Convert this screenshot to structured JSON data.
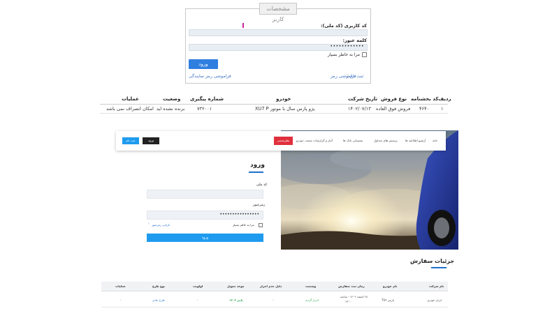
{
  "login_box": {
    "legend": "مشخصات کاربر",
    "national_code_label": "کد کاربری (کد ملی):",
    "password_label": "کلمه عبور:",
    "password_value": "••••••••••••",
    "remember_label": "مرا به خاطر بسپار",
    "login_button": "ورود",
    "register_link": "ثبت نام",
    "separator": "|",
    "forgot_password_link": "فراموشی رمز",
    "forgot_agent_password_link": "فراموشی رمز نمایندگی"
  },
  "orders_table": {
    "headers": [
      "ردیف",
      "کد بخشنامه",
      "نوع فروش",
      "تاریخ شرکت",
      "خودرو",
      "شماره پیگیری",
      "وضعیت",
      "عملیات"
    ],
    "rows": [
      {
        "row": "۱",
        "circular": "۴۶۴۰",
        "sale_type": "فروش فوق العاده",
        "date": "۱۴۰۲/۰۷/۱۳",
        "car": "پژو پارس سال با موتور XU7 P",
        "tracking": "۷۳۲۰۰۱",
        "status": "برنده نشده اید",
        "ops": "امکان انصراف نمی باشد"
      }
    ]
  },
  "navbar": {
    "items": [
      "خانه",
      "آرشیو اطلاعیه ها",
      "پرسش های متداول",
      "پشتیبانی بانک ها",
      "آمار و گزارشات صنعت خودرو"
    ],
    "survey_button": "نظرسنجی",
    "login_button": "ورود",
    "register_button": "ثبت نام"
  },
  "login_form2": {
    "title": "ورود",
    "national_code_label": "کد ملی",
    "password_label": "رمزعبور",
    "password_value": "••••••••••••••••",
    "remember_label": "مرا به خاطر بسپار",
    "forgot_link": "بازیابی رمزعبور",
    "submit_button": "ورود"
  },
  "order_details": {
    "title": "جزئیات سفارش",
    "headers": [
      "نام شرکت",
      "نام خودرو",
      "زمان ثبت سفارش",
      "وضعیت",
      "دلیل عدم احراز",
      "موعد تحویل",
      "اولویت",
      "نوع طرح",
      "عملیات"
    ],
    "row": {
      "company": "ایران خودرو",
      "car": "پارس TU۳",
      "time_line1": "۲۸ اسفند ۱۴۰۲ - ساعت",
      "time_line2": "۱۳:۰۰",
      "status": "احراز گردید",
      "reason": "-",
      "delivery": "پاییز ۱۴۰۳",
      "priority": "-",
      "plan": "طرح عادی",
      "ops": "-"
    }
  },
  "colors": {
    "primary": "#2f7fe0",
    "link": "#3a6fc4",
    "red_button": "#e0303c",
    "dark_button": "#222222",
    "sky_button": "#1e9bef",
    "status_green": "#2fa84f"
  }
}
